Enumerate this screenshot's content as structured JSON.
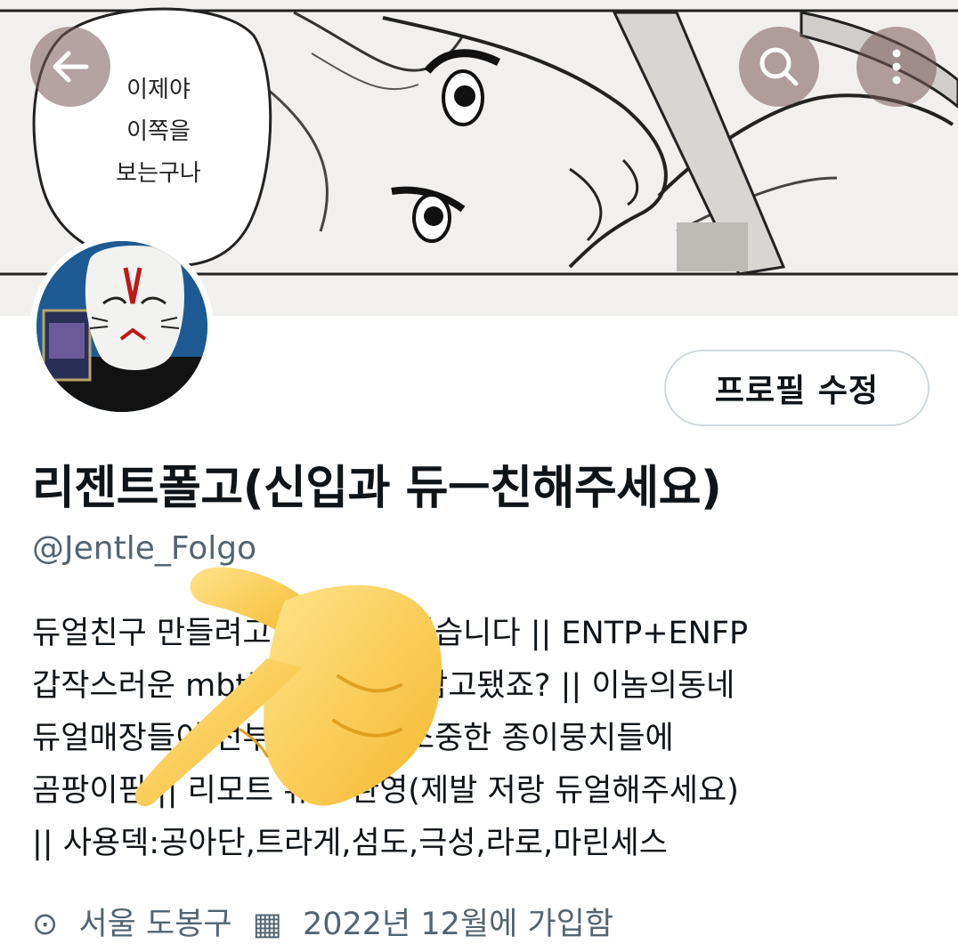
{
  "banner": {
    "speech_lines": [
      "이제야",
      "이쪽을",
      "보는구나"
    ]
  },
  "header_buttons": {
    "back_icon": "arrow-left-icon",
    "search_icon": "search-icon",
    "more_icon": "more-vertical-icon"
  },
  "profile": {
    "edit_label": "프로필 수정",
    "display_name": "리젠트폴고(신입과 듀ㅡ친해주세요)",
    "handle": "@Jentle_Folgo",
    "bio_lines": [
      "듀얼친구 만들려고 계정 만들었습니다 || ENTP+ENFP",
      "갑작스러운 mbti 미안하지만 참고됐죠? || 이놈의동네",
      "듀얼매장들이 전부 망해서 내소중한 종이뭉치들에",
      "곰팡이핌 || 리모트 듀얼 환영(제발 저랑 듀얼해주세요)",
      "|| 사용덱:공아단,트라게,섬도,극성,라로,마린세스"
    ],
    "location": "서울 도봉구",
    "joined": "2022년 12월에 가입함"
  },
  "colors": {
    "secondary_text": "#536471",
    "header_button_bg": "#785858",
    "border": "#cfd9de"
  }
}
